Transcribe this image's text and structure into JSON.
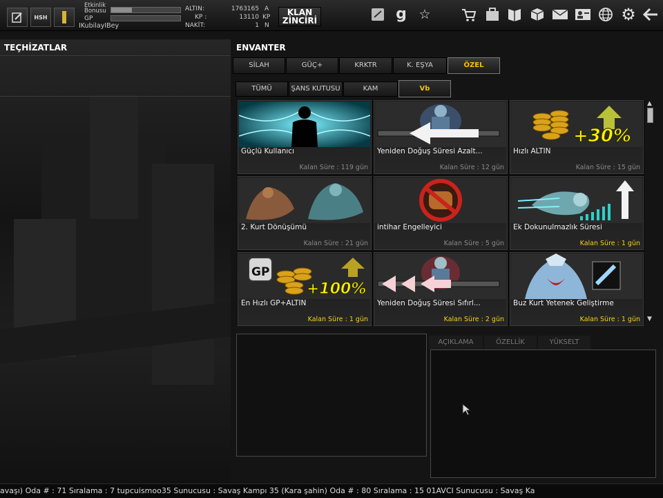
{
  "topbar": {
    "left_icons": [
      "notes-icon",
      "hsh-badge-icon",
      "rank-icon"
    ],
    "hsh_label": "HSH",
    "labels": {
      "event_bonus": "Etkinlik\nBonusu",
      "gp": "GP"
    },
    "event_bonus_fill": 0.3,
    "gp_fill": 0.0,
    "username": "IKubilayIBey",
    "currency": {
      "altin_label": "ALTIN:",
      "altin_value": "1763165",
      "altin_unit": "A",
      "kp_label": "KP :",
      "kp_value": "13110",
      "kp_unit": "KP",
      "nakit_label": "NAKİT:",
      "nakit_value": "1",
      "nakit_unit": "N"
    },
    "klan_button": {
      "line1": "KLAN",
      "line2": "ZİNCİRİ"
    },
    "right_icons": [
      "chat-icon",
      "g-logo-icon",
      "star-icon",
      "cart-icon",
      "inventory-bag-icon",
      "shield-book-icon",
      "box-icon",
      "mail-icon",
      "profile-card-icon",
      "globe-icon",
      "gear-icon",
      "back-arrow-icon"
    ],
    "g_logo": "g"
  },
  "left_panel": {
    "title": "TEÇHİZATLAR"
  },
  "inventory": {
    "title": "ENVANTER",
    "tabs": [
      {
        "label": "SİLAH",
        "active": false
      },
      {
        "label": "GÜÇ+",
        "active": false
      },
      {
        "label": "KRKTR",
        "active": false
      },
      {
        "label": "K. EŞYA",
        "active": false
      },
      {
        "label": "ÖZEL",
        "active": true
      }
    ],
    "subtabs": [
      {
        "label": "TÜMÜ",
        "active": false
      },
      {
        "label": "ŞANS KUTUSU",
        "active": false
      },
      {
        "label": "KAM",
        "active": false
      },
      {
        "label": "Vb",
        "active": true
      }
    ],
    "items": [
      {
        "name": "Güçlü Kullanıcı",
        "time": "Kalan Süre : 119 gün",
        "expiring": false
      },
      {
        "name": "Yeniden Doğuş Süresi Azalt...",
        "time": "Kalan Süre : 12 gün",
        "expiring": false
      },
      {
        "name": "Hızlı ALTIN",
        "time": "Kalan Süre : 15 gün",
        "expiring": false,
        "badge": "+30%"
      },
      {
        "name": "2. Kurt Dönüşümü",
        "time": "Kalan Süre : 21 gün",
        "expiring": false
      },
      {
        "name": "intihar Engelleyici",
        "time": "Kalan Süre : 5 gün",
        "expiring": false
      },
      {
        "name": "Ek Dokunulmazlık Süresi",
        "time": "Kalan Süre : 1 gün",
        "expiring": true
      },
      {
        "name": "En Hızlı GP+ALTIN",
        "time": "Kalan Süre : 1 gün",
        "expiring": true,
        "badge": "+100%",
        "gp_logo": "GP"
      },
      {
        "name": "Yeniden Doğuş Süresi Sıfırl...",
        "time": "Kalan Süre : 2 gün",
        "expiring": true
      },
      {
        "name": "Buz Kurt Yetenek Geliştirme",
        "time": "Kalan Süre : 1 gün",
        "expiring": true
      }
    ]
  },
  "detail_tabs": [
    "AÇIKLAMA",
    "ÖZELLİK",
    "YÜKSELT"
  ],
  "ticker": "avaşı) Oda # : 71          Sıralama : 7 tupcuismoo35 Sunucusu : Savaş Kampı 35 (Kara şahin) Oda # : 80          Sıralama : 15 01AVCI Sunucusu : Savaş Ka",
  "colors": {
    "accent": "#f2c300",
    "expiring": "#f2d21b",
    "normal_time": "#8a8a8a"
  }
}
